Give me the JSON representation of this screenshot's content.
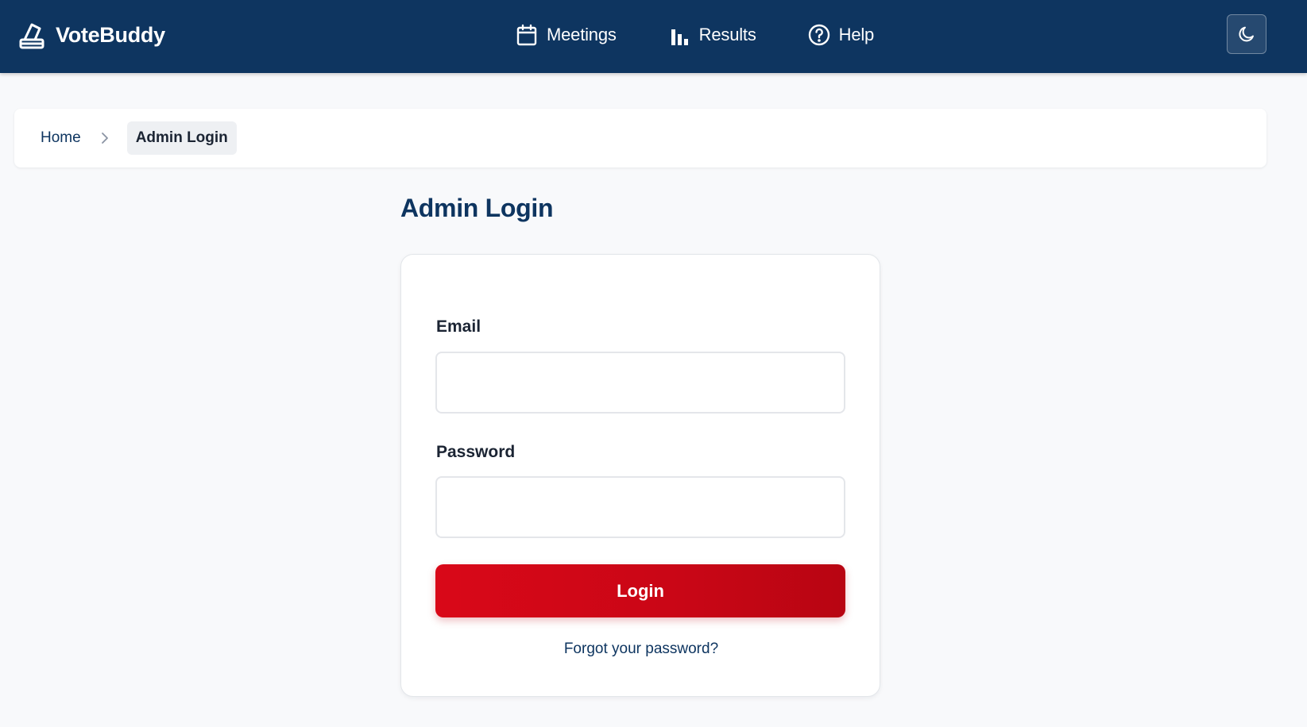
{
  "app": {
    "name": "VoteBuddy"
  },
  "nav": {
    "items": [
      {
        "label": "Meetings",
        "icon": "calendar-icon"
      },
      {
        "label": "Results",
        "icon": "bar-chart-icon"
      },
      {
        "label": "Help",
        "icon": "help-circle-icon"
      }
    ]
  },
  "theme_toggle": {
    "icon": "moon-icon"
  },
  "breadcrumb": {
    "home": "Home",
    "current": "Admin Login"
  },
  "page": {
    "title": "Admin Login"
  },
  "form": {
    "email_label": "Email",
    "email_value": "",
    "password_label": "Password",
    "password_value": "",
    "submit_label": "Login",
    "forgot_link": "Forgot your password?"
  },
  "colors": {
    "header_bg": "#0e3560",
    "primary_button": "#d90818",
    "page_bg": "#f8f9fb"
  }
}
